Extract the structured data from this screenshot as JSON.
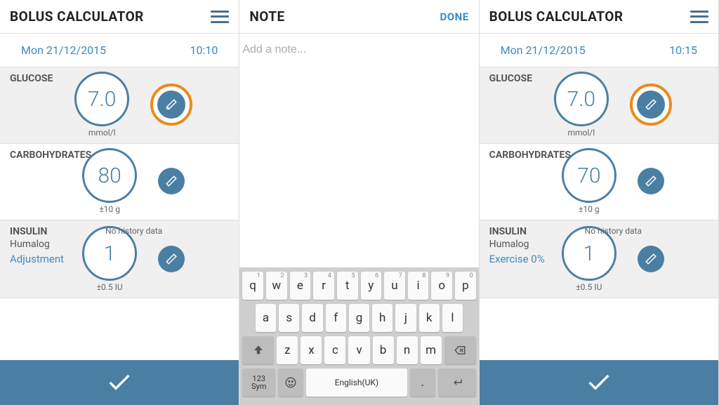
{
  "panel1": {
    "title": "BOLUS CALCULATOR",
    "date": "Mon 21/12/2015",
    "time": "10:10",
    "glucose": {
      "label": "GLUCOSE",
      "value": "7.0",
      "unit": "mmol/l"
    },
    "carbs": {
      "label": "CARBOHYDRATES",
      "value": "80",
      "unit": "±10 g"
    },
    "insulin": {
      "label": "INSULIN",
      "drug": "Humalog",
      "adjustment": "Adjustment",
      "history": "No history data",
      "value": "1",
      "unit": "±0.5 IU"
    }
  },
  "panel2": {
    "title": "NOTE",
    "done": "DONE",
    "placeholder": "Add a note...",
    "keyboard": {
      "row1": [
        "q",
        "w",
        "e",
        "r",
        "t",
        "y",
        "u",
        "i",
        "o",
        "p"
      ],
      "nums": [
        "1",
        "2",
        "3",
        "4",
        "5",
        "6",
        "7",
        "8",
        "9",
        "0"
      ],
      "row2": [
        "a",
        "s",
        "d",
        "f",
        "g",
        "h",
        "j",
        "k",
        "l"
      ],
      "row3": [
        "z",
        "x",
        "c",
        "v",
        "b",
        "n",
        "m"
      ],
      "sym1": "123",
      "sym2": "Sym",
      "space": "English(UK)"
    }
  },
  "panel3": {
    "title": "BOLUS CALCULATOR",
    "date": "Mon 21/12/2015",
    "time": "10:15",
    "glucose": {
      "label": "GLUCOSE",
      "value": "7.0",
      "unit": "mmol/l"
    },
    "carbs": {
      "label": "CARBOHYDRATES",
      "value": "70",
      "unit": "±10 g"
    },
    "insulin": {
      "label": "INSULIN",
      "drug": "Humalog",
      "exercise": "Exercise 0%",
      "history": "No history data",
      "value": "1",
      "unit": "±0.5 IU"
    }
  }
}
